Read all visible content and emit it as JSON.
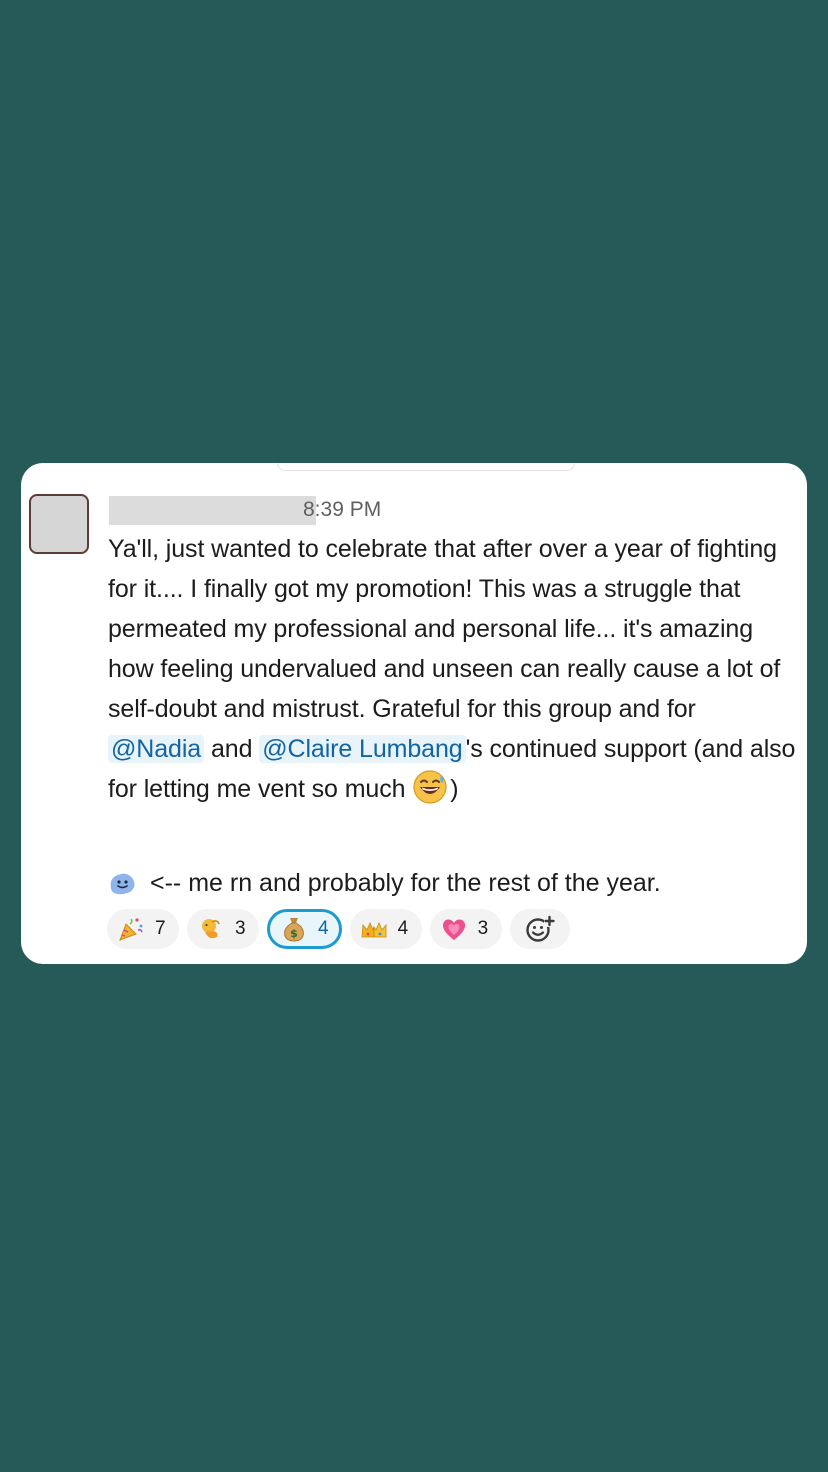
{
  "message": {
    "timestamp": "8:39 PM",
    "lines": {
      "p1": "Ya'll, just wanted to celebrate that after over a year of fighting for it.... I finally got my promotion! This was a struggle that permeated my professional and personal life... it's amazing how feeling undervalued and unseen can really cause a lot of self-doubt and mistrust. Grateful for this group and for ",
      "mention1": "@Nadia",
      "between": " and ",
      "mention2": "@Claire Lumbang",
      "p2": "'s continued support (and also for letting me vent so much ",
      "close": ")"
    },
    "second": "<-- me rn and probably for the rest of the year."
  },
  "reactions": [
    {
      "icon": "party-popper-icon",
      "count": "7"
    },
    {
      "icon": "person-bowing-icon",
      "count": "3"
    },
    {
      "icon": "money-bag-icon",
      "count": "4",
      "selected": true
    },
    {
      "icon": "crowns-icon",
      "count": "4"
    },
    {
      "icon": "growing-heart-icon",
      "count": "3"
    }
  ],
  "colors": {
    "background": "#265a58",
    "mention_bg": "#e8f3fa",
    "mention_text": "#1264a3",
    "selected_border": "#1d9bd1"
  }
}
